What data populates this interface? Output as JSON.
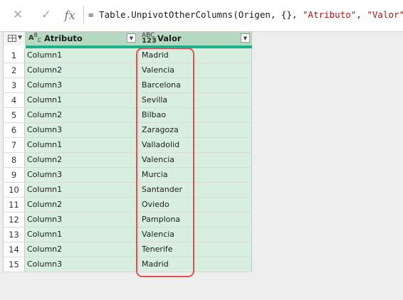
{
  "formula": {
    "prefix": "= Table.UnpivotOtherColumns(Origen, {}, ",
    "arg1": "\"Atributo\"",
    "sep": ", ",
    "arg2": "\"Valor\"",
    "suffix": ")",
    "fx_label": "fx"
  },
  "columns": [
    {
      "label": "Atributo",
      "type_icon": "ABC"
    },
    {
      "label": "Valor",
      "type_icon": "ABC123"
    }
  ],
  "rows": [
    {
      "num": "1",
      "atributo": "Column1",
      "valor": "Madrid"
    },
    {
      "num": "2",
      "atributo": "Column2",
      "valor": "Valencia"
    },
    {
      "num": "3",
      "atributo": "Column3",
      "valor": "Barcelona"
    },
    {
      "num": "4",
      "atributo": "Column1",
      "valor": "Sevilla"
    },
    {
      "num": "5",
      "atributo": "Column2",
      "valor": "Bilbao"
    },
    {
      "num": "6",
      "atributo": "Column3",
      "valor": "Zaragoza"
    },
    {
      "num": "7",
      "atributo": "Column1",
      "valor": "Valladolid"
    },
    {
      "num": "8",
      "atributo": "Column2",
      "valor": "Valencia"
    },
    {
      "num": "9",
      "atributo": "Column3",
      "valor": "Murcia"
    },
    {
      "num": "10",
      "atributo": "Column1",
      "valor": "Santander"
    },
    {
      "num": "11",
      "atributo": "Column2",
      "valor": "Oviedo"
    },
    {
      "num": "12",
      "atributo": "Column3",
      "valor": "Pamplona"
    },
    {
      "num": "13",
      "atributo": "Column1",
      "valor": "Valencia"
    },
    {
      "num": "14",
      "atributo": "Column2",
      "valor": "Tenerife"
    },
    {
      "num": "15",
      "atributo": "Column3",
      "valor": "Madrid"
    }
  ],
  "colors": {
    "header_fill": "#b5d9c1",
    "cell_fill": "#d8efdf",
    "quality_bar": "#1db08a",
    "highlight": "#e05252"
  }
}
